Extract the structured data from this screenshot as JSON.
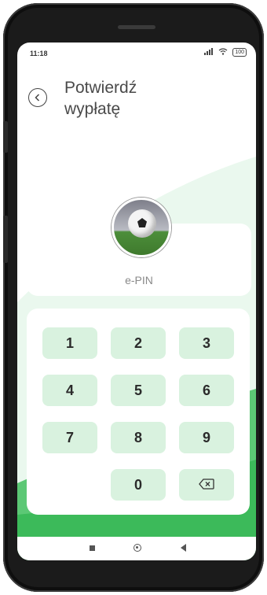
{
  "status": {
    "time": "11:18",
    "battery": "100"
  },
  "header": {
    "title": "Potwierdź\nwypłatę"
  },
  "epin": {
    "label": "e-PIN"
  },
  "keypad": {
    "keys": [
      "1",
      "2",
      "3",
      "4",
      "5",
      "6",
      "7",
      "8",
      "9",
      "0"
    ]
  },
  "colors": {
    "accent_green": "#3cba5a",
    "key_bg": "#d9f2df"
  }
}
